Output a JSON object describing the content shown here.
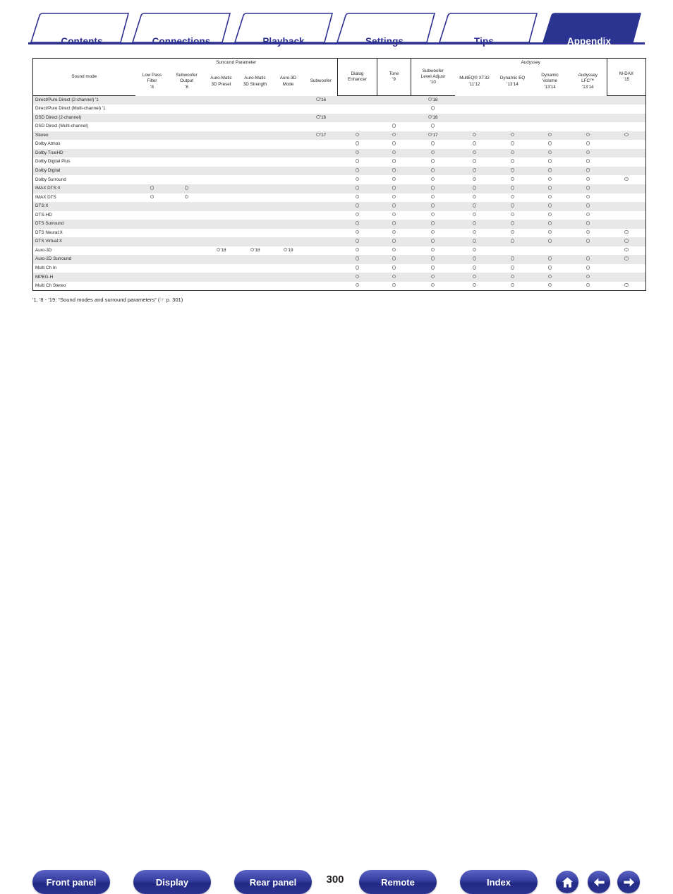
{
  "tabs": [
    {
      "label": "Contents",
      "active": false
    },
    {
      "label": "Connections",
      "active": false
    },
    {
      "label": "Playback",
      "active": false
    },
    {
      "label": "Settings",
      "active": false
    },
    {
      "label": "Tips",
      "active": false
    },
    {
      "label": "Appendix",
      "active": true
    }
  ],
  "table": {
    "group_headers": {
      "sound_mode": "Sound mode",
      "surround_parameter": "Surround Parameter",
      "audyssey": "Audyssey"
    },
    "columns": [
      {
        "id": "sound_mode",
        "lines": [
          "Sound mode"
        ]
      },
      {
        "id": "low_pass_filter",
        "lines": [
          "Low Pass",
          "Filter",
          "'8"
        ]
      },
      {
        "id": "subwoofer_output",
        "lines": [
          "Subwoofer",
          "Output",
          "'8"
        ]
      },
      {
        "id": "auro_matic_3d_preset",
        "lines": [
          "Auro-Matic",
          "3D Preset"
        ]
      },
      {
        "id": "auro_matic_3d_strength",
        "lines": [
          "Auro-Matic",
          "3D Strength"
        ]
      },
      {
        "id": "auro_3d_mode",
        "lines": [
          "Auro-3D",
          "Mode"
        ]
      },
      {
        "id": "subwoofer",
        "lines": [
          "Subwoofer"
        ]
      },
      {
        "id": "dialog_enhancer",
        "lines": [
          "Dialog",
          "Enhancer"
        ]
      },
      {
        "id": "tone",
        "lines": [
          "Tone",
          "'9"
        ]
      },
      {
        "id": "subwoofer_level_adjust",
        "lines": [
          "Subwoofer",
          "Level Adjust",
          "'10"
        ]
      },
      {
        "id": "multeq_xt32",
        "lines": [
          "MultEQ® XT32",
          "'11'12"
        ]
      },
      {
        "id": "dynamic_eq",
        "lines": [
          "Dynamic EQ",
          "'13'14"
        ]
      },
      {
        "id": "dynamic_volume",
        "lines": [
          "Dynamic",
          "Volume",
          "'13'14"
        ]
      },
      {
        "id": "audyssey_lfc",
        "lines": [
          "Audyssey",
          "LFC™",
          "'13'14"
        ]
      },
      {
        "id": "m_dax",
        "lines": [
          "M-DAX",
          "'15"
        ]
      }
    ],
    "rows": [
      {
        "label": "Direct/Pure Direct (2-channel) '1",
        "cells": [
          "",
          "",
          "",
          "",
          "",
          "O'16",
          "",
          "",
          "O'16",
          "",
          "",
          "",
          "",
          ""
        ]
      },
      {
        "label": "Direct/Pure Direct (Multi-channel) '1",
        "cells": [
          "",
          "",
          "",
          "",
          "",
          "",
          "",
          "",
          "O",
          "",
          "",
          "",
          "",
          ""
        ]
      },
      {
        "label": "DSD Direct (2-channel)",
        "cells": [
          "",
          "",
          "",
          "",
          "",
          "O'16",
          "",
          "",
          "O'16",
          "",
          "",
          "",
          "",
          ""
        ]
      },
      {
        "label": "DSD Direct (Multi-channel)",
        "cells": [
          "",
          "",
          "",
          "",
          "",
          "",
          "",
          "O",
          "O",
          "",
          "",
          "",
          "",
          ""
        ]
      },
      {
        "label": "Stereo",
        "cells": [
          "",
          "",
          "",
          "",
          "",
          "O'17",
          "O",
          "O",
          "O'17",
          "O",
          "O",
          "O",
          "O",
          "O"
        ]
      },
      {
        "label": "Dolby Atmos",
        "cells": [
          "",
          "",
          "",
          "",
          "",
          "",
          "O",
          "O",
          "O",
          "O",
          "O",
          "O",
          "O",
          ""
        ]
      },
      {
        "label": "Dolby TrueHD",
        "cells": [
          "",
          "",
          "",
          "",
          "",
          "",
          "O",
          "O",
          "O",
          "O",
          "O",
          "O",
          "O",
          ""
        ]
      },
      {
        "label": "Dolby Digital Plus",
        "cells": [
          "",
          "",
          "",
          "",
          "",
          "",
          "O",
          "O",
          "O",
          "O",
          "O",
          "O",
          "O",
          ""
        ]
      },
      {
        "label": "Dolby Digital",
        "cells": [
          "",
          "",
          "",
          "",
          "",
          "",
          "O",
          "O",
          "O",
          "O",
          "O",
          "O",
          "O",
          ""
        ]
      },
      {
        "label": "Dolby Surround",
        "cells": [
          "",
          "",
          "",
          "",
          "",
          "",
          "O",
          "O",
          "O",
          "O",
          "O",
          "O",
          "O",
          "O"
        ]
      },
      {
        "label": "IMAX DTS:X",
        "cells": [
          "O",
          "O",
          "",
          "",
          "",
          "",
          "O",
          "O",
          "O",
          "O",
          "O",
          "O",
          "O",
          ""
        ]
      },
      {
        "label": "IMAX DTS",
        "cells": [
          "O",
          "O",
          "",
          "",
          "",
          "",
          "O",
          "O",
          "O",
          "O",
          "O",
          "O",
          "O",
          ""
        ]
      },
      {
        "label": "DTS:X",
        "cells": [
          "",
          "",
          "",
          "",
          "",
          "",
          "O",
          "O",
          "O",
          "O",
          "O",
          "O",
          "O",
          ""
        ]
      },
      {
        "label": "DTS-HD",
        "cells": [
          "",
          "",
          "",
          "",
          "",
          "",
          "O",
          "O",
          "O",
          "O",
          "O",
          "O",
          "O",
          ""
        ]
      },
      {
        "label": "DTS Surround",
        "cells": [
          "",
          "",
          "",
          "",
          "",
          "",
          "O",
          "O",
          "O",
          "O",
          "O",
          "O",
          "O",
          ""
        ]
      },
      {
        "label": "DTS Neural:X",
        "cells": [
          "",
          "",
          "",
          "",
          "",
          "",
          "O",
          "O",
          "O",
          "O",
          "O",
          "O",
          "O",
          "O"
        ]
      },
      {
        "label": "DTS Virtual:X",
        "cells": [
          "",
          "",
          "",
          "",
          "",
          "",
          "O",
          "O",
          "O",
          "O",
          "O",
          "O",
          "O",
          "O"
        ]
      },
      {
        "label": "Auro-3D",
        "cells": [
          "",
          "",
          "O'18",
          "O'18",
          "O'19",
          "",
          "O",
          "O",
          "O",
          "O",
          "",
          "",
          "",
          "O"
        ]
      },
      {
        "label": "Auro-2D Surround",
        "cells": [
          "",
          "",
          "",
          "",
          "",
          "",
          "O",
          "O",
          "O",
          "O",
          "O",
          "O",
          "O",
          "O"
        ]
      },
      {
        "label": "Multi Ch In",
        "cells": [
          "",
          "",
          "",
          "",
          "",
          "",
          "O",
          "O",
          "O",
          "O",
          "O",
          "O",
          "O",
          ""
        ]
      },
      {
        "label": "MPEG-H",
        "cells": [
          "",
          "",
          "",
          "",
          "",
          "",
          "O",
          "O",
          "O",
          "O",
          "O",
          "O",
          "O",
          ""
        ]
      },
      {
        "label": "Multi Ch Stereo",
        "cells": [
          "",
          "",
          "",
          "",
          "",
          "",
          "O",
          "O",
          "O",
          "O",
          "O",
          "O",
          "O",
          "O"
        ]
      }
    ]
  },
  "footnote": {
    "prefix": "'1, '8 - '19: “Sound modes and surround parameters” (",
    "page_ref": " p. 301)"
  },
  "bottom_nav": {
    "buttons": [
      {
        "label": "Front panel"
      },
      {
        "label": "Display"
      },
      {
        "label": "Rear panel"
      },
      {
        "label": "Remote"
      },
      {
        "label": "Index"
      }
    ],
    "page_number": "300",
    "icons": [
      "home-icon",
      "back-arrow-icon",
      "forward-arrow-icon"
    ]
  },
  "colors": {
    "brand_blue": "#2e3192",
    "tab_active_bg": "#2b3490",
    "row_alt_bg": "#e8e8e8",
    "table_border": "#231f20",
    "circle_stroke": "#8a8a8a"
  }
}
